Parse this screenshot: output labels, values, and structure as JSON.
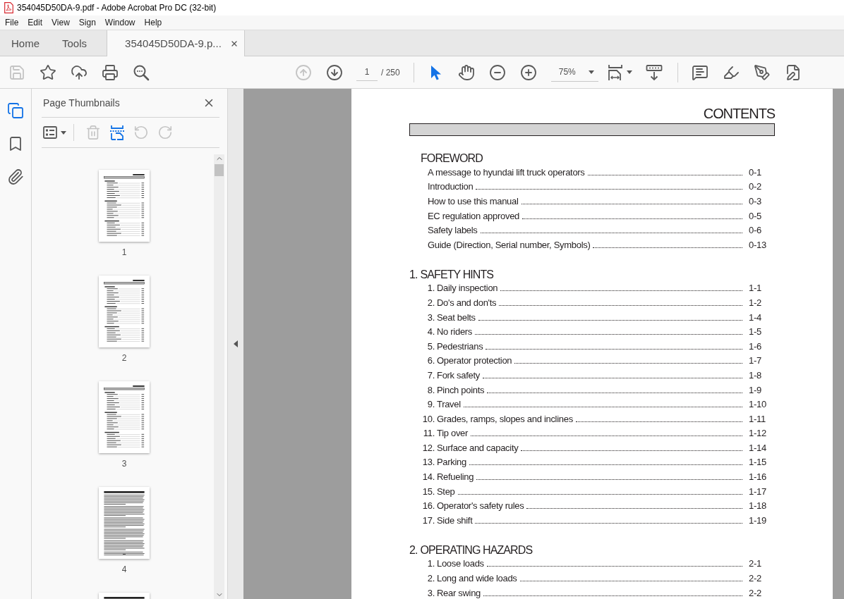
{
  "window": {
    "title": "354045D50DA-9.pdf - Adobe Acrobat Pro DC (32-bit)"
  },
  "menu": [
    "File",
    "Edit",
    "View",
    "Sign",
    "Window",
    "Help"
  ],
  "tabs": [
    {
      "label": "Home",
      "selected": false,
      "closable": false
    },
    {
      "label": "Tools",
      "selected": false,
      "closable": false
    },
    {
      "label": "354045D50DA-9.p...",
      "selected": true,
      "closable": true
    }
  ],
  "toolbar": {
    "file_buttons": [
      {
        "kind": "save",
        "disabled": true
      },
      {
        "kind": "star",
        "disabled": false
      },
      {
        "kind": "upload",
        "disabled": false
      },
      {
        "kind": "print",
        "disabled": false
      },
      {
        "kind": "find",
        "disabled": false
      }
    ],
    "page_nav": [
      {
        "kind": "previous",
        "disabled": true
      },
      {
        "kind": "next",
        "disabled": false
      }
    ],
    "page_field": {
      "value": "1"
    },
    "page_count": "/ 250",
    "tools": [
      {
        "kind": "select",
        "selected": true
      },
      {
        "kind": "hand",
        "selected": false
      }
    ],
    "zoom_field": {
      "value": "75%"
    }
  },
  "rail": [
    {
      "kind": "pages",
      "selected": true
    },
    {
      "kind": "bookmarks",
      "selected": false
    },
    {
      "kind": "attachments",
      "selected": false
    }
  ],
  "sidebar": {
    "title": "Page Thumbnails",
    "tools": [
      {
        "kind": "options",
        "disabled": false
      },
      {
        "kind": "delete",
        "disabled": true
      },
      {
        "kind": "insert",
        "disabled": false
      },
      {
        "kind": "rotate_left",
        "disabled": true
      },
      {
        "kind": "rotate_right",
        "disabled": true
      }
    ],
    "thumbnails": [
      {
        "kind": "contents",
        "label": "1"
      },
      {
        "kind": "contents",
        "label": "2"
      },
      {
        "kind": "contents",
        "label": "3"
      },
      {
        "kind": "text",
        "label": "4"
      },
      {
        "kind": "text"
      }
    ]
  },
  "document": {
    "heading": "CONTENTS",
    "sections": [
      {
        "title": "FOREWORD",
        "entries": [
          {
            "text": "A message to hyundai lift truck operators",
            "page": "0-1"
          },
          {
            "text": "Introduction",
            "page": "0-2"
          },
          {
            "text": "How to use this manual",
            "page": "0-3"
          },
          {
            "text": "EC regulation approved",
            "page": "0-5"
          },
          {
            "text": "Safety labels",
            "page": "0-6"
          },
          {
            "text": "Guide (Direction, Serial number, Symbols)",
            "page": "0-13"
          }
        ]
      },
      {
        "number": "1.",
        "title": "SAFETY HINTS",
        "entries": [
          {
            "number": "1.",
            "text": "Daily inspection",
            "page": "1-1"
          },
          {
            "number": "2.",
            "text": "Do's and don'ts",
            "page": "1-2"
          },
          {
            "number": "3.",
            "text": "Seat belts",
            "page": "1-4"
          },
          {
            "number": "4.",
            "text": "No riders",
            "page": "1-5"
          },
          {
            "number": "5.",
            "text": "Pedestrians",
            "page": "1-6"
          },
          {
            "number": "6.",
            "text": "Operator protection",
            "page": "1-7"
          },
          {
            "number": "7.",
            "text": "Fork safety",
            "page": "1-8"
          },
          {
            "number": "8.",
            "text": "Pinch points",
            "page": "1-9"
          },
          {
            "number": "9.",
            "text": "Travel",
            "page": "1-10"
          },
          {
            "number": "10.",
            "text": "Grades, ramps, slopes and inclines",
            "page": "1-11"
          },
          {
            "number": "11.",
            "text": "Tip over",
            "page": "1-12"
          },
          {
            "number": "12.",
            "text": "Surface and capacity",
            "page": "1-14"
          },
          {
            "number": "13.",
            "text": "Parking",
            "page": "1-15"
          },
          {
            "number": "14.",
            "text": "Refueling",
            "page": "1-16"
          },
          {
            "number": "15.",
            "text": "Step",
            "page": "1-17"
          },
          {
            "number": "16.",
            "text": "Operator's safety rules",
            "page": "1-18"
          },
          {
            "number": "17.",
            "text": "Side shift",
            "page": "1-19"
          }
        ]
      },
      {
        "number": "2.",
        "title": "OPERATING HAZARDS",
        "entries": [
          {
            "number": "1.",
            "text": "Loose loads",
            "page": "2-1"
          },
          {
            "number": "2.",
            "text": "Long and wide loads",
            "page": "2-2"
          },
          {
            "number": "3.",
            "text": "Rear swing",
            "page": "2-2"
          }
        ]
      }
    ]
  }
}
